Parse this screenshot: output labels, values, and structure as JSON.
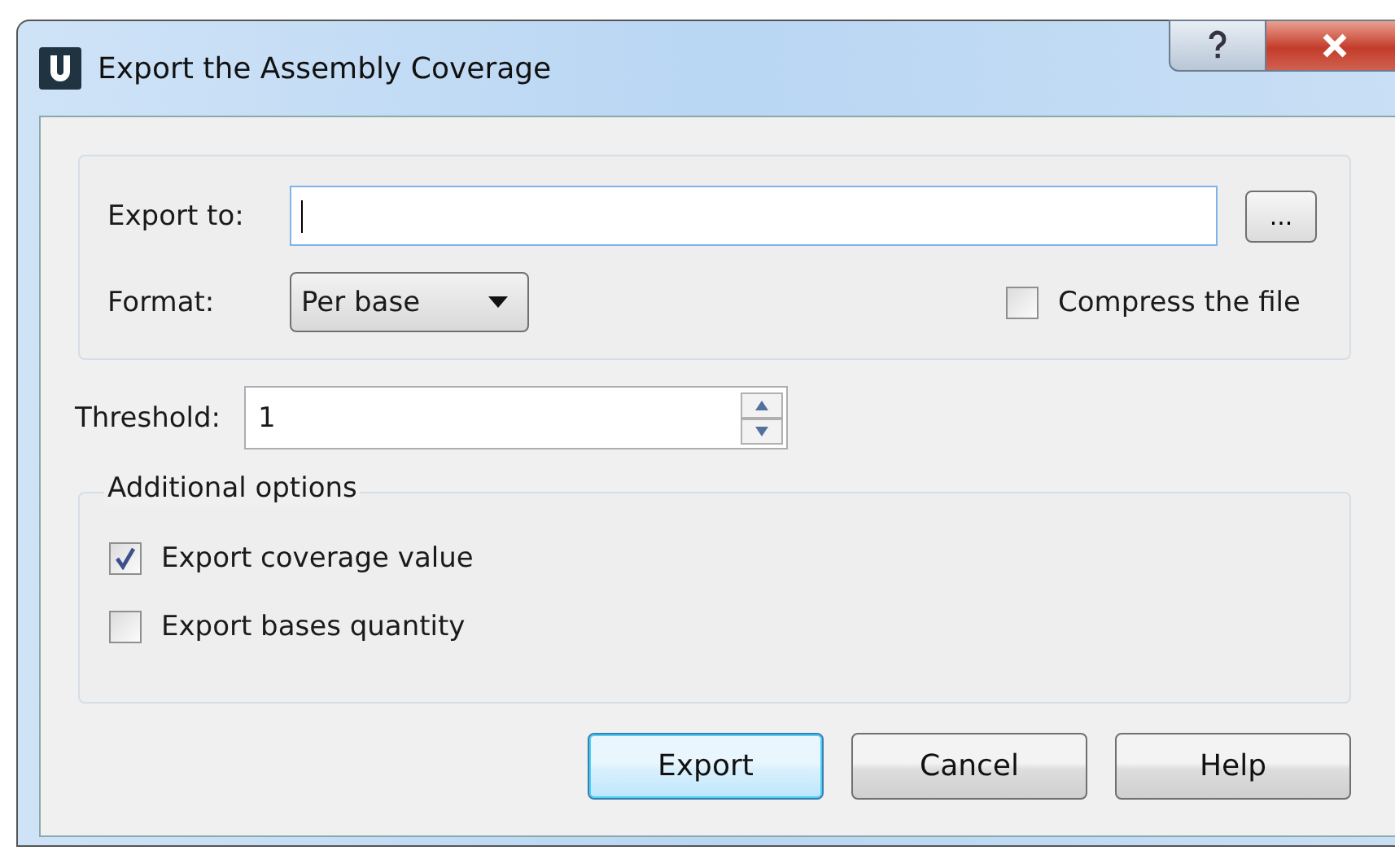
{
  "window": {
    "title": "Export the Assembly Coverage"
  },
  "export_to": {
    "label": "Export to:",
    "focused": true,
    "browse_button": "..."
  },
  "format": {
    "label": "Format:",
    "value": "Per base"
  },
  "compress": {
    "label": "Compress the file",
    "checked": false
  },
  "threshold": {
    "label": "Threshold:",
    "value": "1"
  },
  "additional_options": {
    "title": "Additional options",
    "options": [
      {
        "label": "Export coverage value",
        "checked": true
      },
      {
        "label": "Export bases quantity",
        "checked": false
      }
    ]
  },
  "buttons": [
    {
      "label": "Export",
      "default": true
    },
    {
      "label": "Cancel",
      "default": false
    },
    {
      "label": "Help",
      "default": false
    }
  ]
}
